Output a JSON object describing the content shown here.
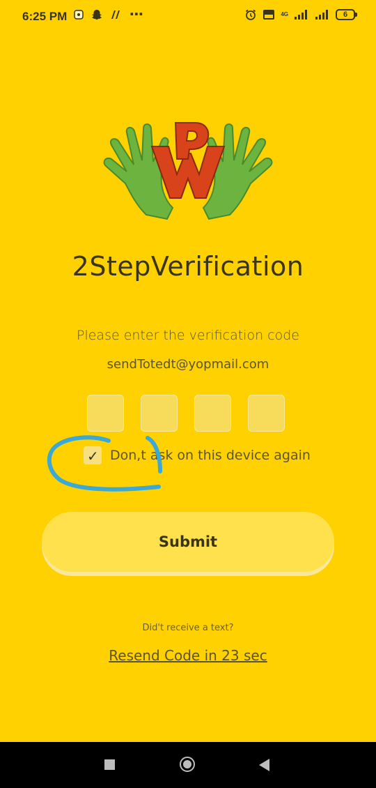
{
  "status_bar": {
    "time": "6:25 PM",
    "left_icons": [
      "notification-icon",
      "snapchat-icon",
      "app-icon"
    ],
    "overflow": "⋯",
    "right_icons": [
      "alarm-icon",
      "volte-icon",
      "signal-4g-icon",
      "signal-icon"
    ],
    "net_label": "4G",
    "battery": "6"
  },
  "logo": {
    "letters": "WP"
  },
  "title": "2StepVerification",
  "subtitle": "Please enter the verification code",
  "email": "sendTotedt@yopmail.com",
  "code_boxes": [
    "",
    "",
    "",
    ""
  ],
  "remember": {
    "label": "Don,t ask on this device again",
    "checked": true
  },
  "submit_label": "Submit",
  "no_text": "Did't receive a text?",
  "resend": "Resend Code in 23 sec",
  "colors": {
    "background": "#FFD100",
    "button": "#FFE14E",
    "annotation": "#3BA9D6"
  }
}
